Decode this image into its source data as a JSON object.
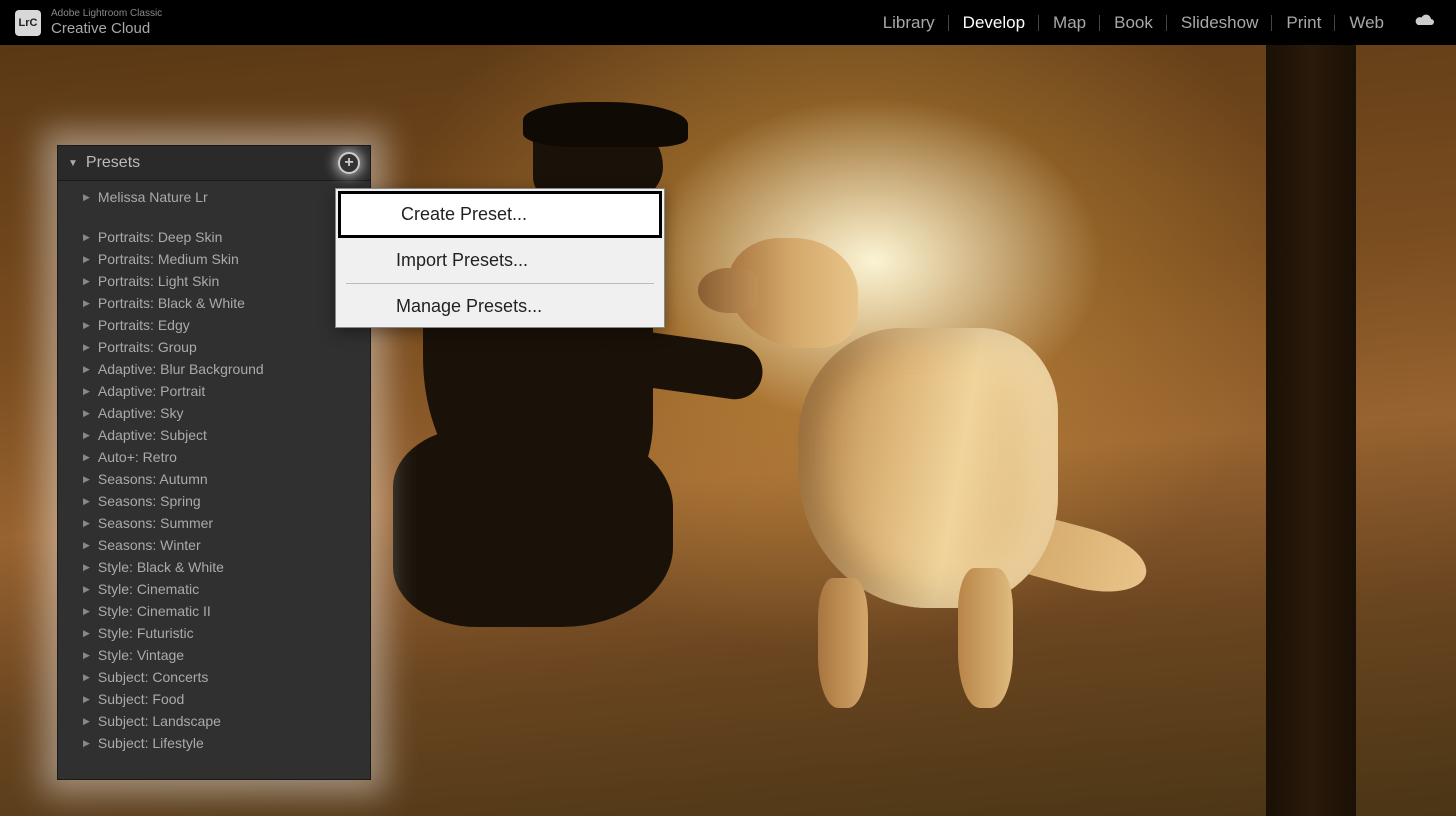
{
  "app": {
    "iconText": "LrC",
    "smallTitle": "Adobe Lightroom Classic",
    "largeTitle": "Creative Cloud"
  },
  "nav": {
    "items": [
      {
        "label": "Library",
        "active": false
      },
      {
        "label": "Develop",
        "active": true
      },
      {
        "label": "Map",
        "active": false
      },
      {
        "label": "Book",
        "active": false
      },
      {
        "label": "Slideshow",
        "active": false
      },
      {
        "label": "Print",
        "active": false
      },
      {
        "label": "Web",
        "active": false
      }
    ]
  },
  "presets": {
    "title": "Presets",
    "userItem": "Melissa Nature Lr",
    "items": [
      "Portraits: Deep Skin",
      "Portraits: Medium Skin",
      "Portraits: Light Skin",
      "Portraits: Black & White",
      "Portraits: Edgy",
      "Portraits: Group",
      "Adaptive: Blur Background",
      "Adaptive: Portrait",
      "Adaptive: Sky",
      "Adaptive: Subject",
      "Auto+: Retro",
      "Seasons: Autumn",
      "Seasons: Spring",
      "Seasons: Summer",
      "Seasons: Winter",
      "Style: Black & White",
      "Style: Cinematic",
      "Style: Cinematic II",
      "Style: Futuristic",
      "Style: Vintage",
      "Subject: Concerts",
      "Subject: Food",
      "Subject: Landscape",
      "Subject: Lifestyle"
    ]
  },
  "contextMenu": {
    "createPreset": "Create Preset...",
    "importPresets": "Import Presets...",
    "managePresets": "Manage Presets..."
  }
}
